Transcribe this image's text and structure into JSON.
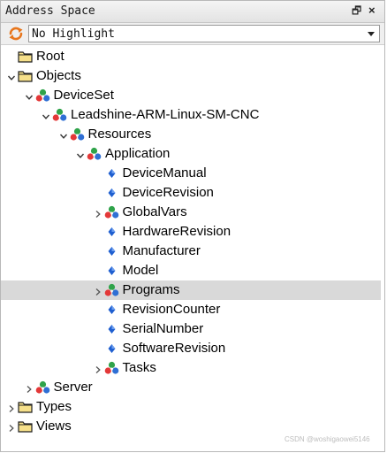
{
  "panel": {
    "title": "Address Space",
    "float_glyph": "🗗",
    "close_glyph": "×"
  },
  "toolbar": {
    "refresh_icon": "refresh-icon",
    "highlight_value": "No Highlight"
  },
  "tree": [
    {
      "label": "Root",
      "level": 0,
      "expander": "none",
      "icon": "folder"
    },
    {
      "label": "Objects",
      "level": 0,
      "expander": "expanded",
      "icon": "folder"
    },
    {
      "label": "DeviceSet",
      "level": 1,
      "expander": "expanded",
      "icon": "object"
    },
    {
      "label": "Leadshine-ARM-Linux-SM-CNC",
      "level": 2,
      "expander": "expanded",
      "icon": "object"
    },
    {
      "label": "Resources",
      "level": 3,
      "expander": "expanded",
      "icon": "object"
    },
    {
      "label": "Application",
      "level": 4,
      "expander": "expanded",
      "icon": "object"
    },
    {
      "label": "DeviceManual",
      "level": 5,
      "expander": "none",
      "icon": "variable"
    },
    {
      "label": "DeviceRevision",
      "level": 5,
      "expander": "none",
      "icon": "variable"
    },
    {
      "label": "GlobalVars",
      "level": 5,
      "expander": "collapsed",
      "icon": "object"
    },
    {
      "label": "HardwareRevision",
      "level": 5,
      "expander": "none",
      "icon": "variable"
    },
    {
      "label": "Manufacturer",
      "level": 5,
      "expander": "none",
      "icon": "variable"
    },
    {
      "label": "Model",
      "level": 5,
      "expander": "none",
      "icon": "variable"
    },
    {
      "label": "Programs",
      "level": 5,
      "expander": "collapsed",
      "icon": "object",
      "selected": true
    },
    {
      "label": "RevisionCounter",
      "level": 5,
      "expander": "none",
      "icon": "variable"
    },
    {
      "label": "SerialNumber",
      "level": 5,
      "expander": "none",
      "icon": "variable"
    },
    {
      "label": "SoftwareRevision",
      "level": 5,
      "expander": "none",
      "icon": "variable"
    },
    {
      "label": "Tasks",
      "level": 5,
      "expander": "collapsed",
      "icon": "object"
    },
    {
      "label": "Server",
      "level": 1,
      "expander": "collapsed",
      "icon": "object"
    },
    {
      "label": "Types",
      "level": 0,
      "expander": "collapsed",
      "icon": "folder"
    },
    {
      "label": "Views",
      "level": 0,
      "expander": "collapsed",
      "icon": "folder"
    }
  ],
  "watermark": "CSDN @woshigaowei5146"
}
